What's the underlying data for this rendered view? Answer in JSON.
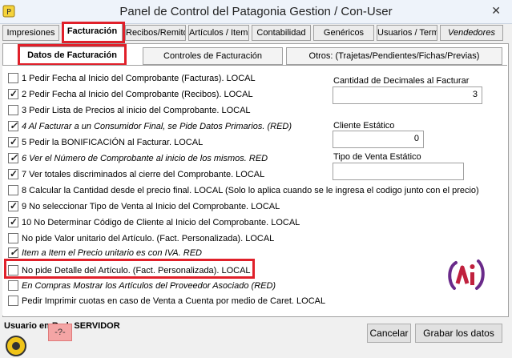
{
  "window": {
    "title": "Panel de Control del Patagonia Gestion / Con-User",
    "close_symbol": "✕"
  },
  "tabs": [
    {
      "label": "Impresiones"
    },
    {
      "label": "Facturación"
    },
    {
      "label": "Recibos/Remitos"
    },
    {
      "label": "Artículos / Items"
    },
    {
      "label": "Contabilidad"
    },
    {
      "label": "Genéricos"
    },
    {
      "label": "Usuarios / Terminales"
    },
    {
      "label": "Vendedores"
    }
  ],
  "subtabs": [
    {
      "label": "Datos de Facturación"
    },
    {
      "label": "Controles de Facturación"
    },
    {
      "label": "Otros: (Trajetas/Pendientes/Fichas/Previas)"
    }
  ],
  "options": [
    {
      "label": "1 Pedir Fecha al Inicio del Comprobante (Facturas). LOCAL",
      "checked": false
    },
    {
      "label": "2 Pedir Fecha al Inicio del Comprobante (Recibos). LOCAL",
      "checked": true
    },
    {
      "label": "3 Pedir Lista de Precios al inicio del Comprobante. LOCAL",
      "checked": false
    },
    {
      "label": "4 Al Facturar a un Consumidor Final, se Pide Datos Primarios. (RED)",
      "checked": true
    },
    {
      "label": "5 Pedir la BONIFICACIÓN al Facturar. LOCAL",
      "checked": true
    },
    {
      "label": "6 Ver el Número de Comprobante al inicio de los mismos. RED",
      "checked": true
    },
    {
      "label": "7 Ver totales discriminados al cierre del Comprobante. LOCAL",
      "checked": true
    },
    {
      "label": "8 Calcular la Cantidad desde el precio final. LOCAL (Solo lo aplica cuando se le ingresa el codigo junto con el precio)",
      "checked": false
    },
    {
      "label": "9 No seleccionar Tipo de Venta al Inicio del Comprobante. LOCAL",
      "checked": true
    },
    {
      "label": "10 No Determinar Código de Cliente al Inicio del Comprobante. LOCAL",
      "checked": true
    },
    {
      "label": "No pide Valor unitario del Artículo. (Fact. Personalizada). LOCAL",
      "checked": false
    },
    {
      "label": "Item a Item el Precio unitario es con IVA. RED",
      "checked": true
    },
    {
      "label": "No pide Detalle del Artículo. (Fact. Personalizada). LOCAL",
      "checked": false
    },
    {
      "label": "En Compras Mostrar los Artículos del Proveedor Asociado (RED)",
      "checked": false
    },
    {
      "label": "Pedir Imprimir cuotas en caso de Venta a Cuenta por medio de Caret. LOCAL",
      "checked": false
    }
  ],
  "fields": {
    "decimales": {
      "label": "Cantidad de Decimales al Facturar",
      "value": "3"
    },
    "cliente": {
      "label": "Cliente Estático",
      "value": "0"
    },
    "tipo_venta": {
      "label": "Tipo de Venta Estático",
      "value": ""
    }
  },
  "status": {
    "text": "Usuario en Red: SERVIDOR",
    "badge": "-?-"
  },
  "buttons": {
    "cancel": "Cancelar",
    "save": "Grabar los datos"
  },
  "highlight_color": "#e0202a",
  "logo_colors": {
    "primary": "#c0213e",
    "secondary": "#6a2a8a"
  }
}
